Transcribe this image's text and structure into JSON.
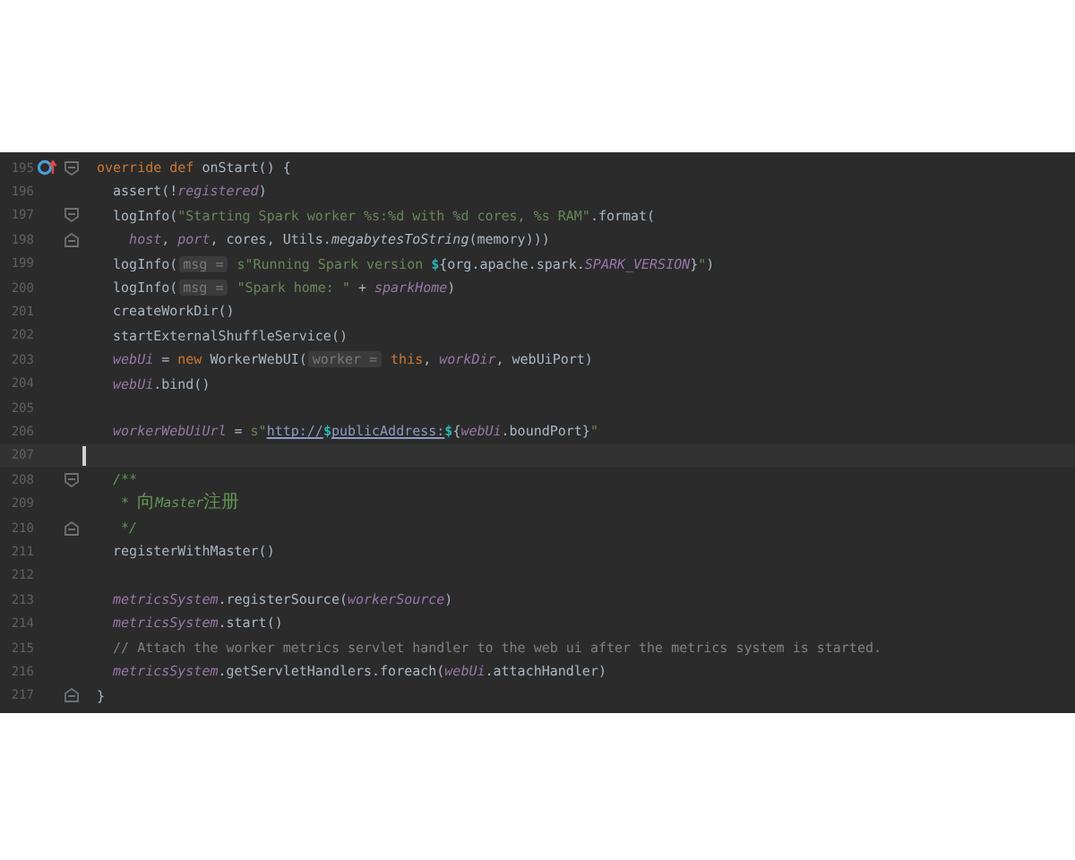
{
  "editor": {
    "lines": [
      {
        "number": "195",
        "overridden": true,
        "fold_start": true,
        "tokens": [
          {
            "kind": "keyword",
            "text": "override def "
          },
          {
            "kind": "plain",
            "text": "onStart() {"
          }
        ]
      },
      {
        "number": "196",
        "tokens": [
          {
            "kind": "plain",
            "text": "  assert(!"
          },
          {
            "kind": "field",
            "text": "registered"
          },
          {
            "kind": "plain",
            "text": ")"
          }
        ]
      },
      {
        "number": "197",
        "fold_start": true,
        "tokens": [
          {
            "kind": "plain",
            "text": "  logInfo("
          },
          {
            "kind": "string",
            "text": "\"Starting Spark worker %s:%d with %d cores, %s RAM\""
          },
          {
            "kind": "plain",
            "text": ".format("
          }
        ]
      },
      {
        "number": "198",
        "fold_end": true,
        "tokens": [
          {
            "kind": "field",
            "text": "    host"
          },
          {
            "kind": "plain",
            "text": ", "
          },
          {
            "kind": "field",
            "text": "port"
          },
          {
            "kind": "plain",
            "text": ", cores, Utils."
          },
          {
            "kind": "italic",
            "text": "megabytesToString"
          },
          {
            "kind": "plain",
            "text": "(memory)))"
          }
        ]
      },
      {
        "number": "199",
        "tokens": [
          {
            "kind": "plain",
            "text": "  logInfo("
          },
          {
            "kind": "hint",
            "text": "msg ="
          },
          {
            "kind": "string",
            "text": " s\"Running Spark version "
          },
          {
            "kind": "interp",
            "text": "$"
          },
          {
            "kind": "plain",
            "text": "{org.apache.spark."
          },
          {
            "kind": "field",
            "text": "SPARK_VERSION"
          },
          {
            "kind": "plain",
            "text": "}"
          },
          {
            "kind": "string",
            "text": "\""
          },
          {
            "kind": "plain",
            "text": ")"
          }
        ]
      },
      {
        "number": "200",
        "tokens": [
          {
            "kind": "plain",
            "text": "  logInfo("
          },
          {
            "kind": "hint",
            "text": "msg ="
          },
          {
            "kind": "string",
            "text": " \"Spark home: \""
          },
          {
            "kind": "plain",
            "text": " + "
          },
          {
            "kind": "field",
            "text": "sparkHome"
          },
          {
            "kind": "plain",
            "text": ")"
          }
        ]
      },
      {
        "number": "201",
        "tokens": [
          {
            "kind": "plain",
            "text": "  createWorkDir()"
          }
        ]
      },
      {
        "number": "202",
        "tokens": [
          {
            "kind": "plain",
            "text": "  startExternalShuffleService()"
          }
        ]
      },
      {
        "number": "203",
        "tokens": [
          {
            "kind": "field",
            "text": "  webUi"
          },
          {
            "kind": "plain",
            "text": " = "
          },
          {
            "kind": "keyword",
            "text": "new "
          },
          {
            "kind": "plain",
            "text": "WorkerWebUI("
          },
          {
            "kind": "hint",
            "text": "worker ="
          },
          {
            "kind": "keyword",
            "text": " this"
          },
          {
            "kind": "plain",
            "text": ", "
          },
          {
            "kind": "field",
            "text": "workDir"
          },
          {
            "kind": "plain",
            "text": ", webUiPort)"
          }
        ]
      },
      {
        "number": "204",
        "tokens": [
          {
            "kind": "field",
            "text": "  webUi"
          },
          {
            "kind": "plain",
            "text": ".bind()"
          }
        ]
      },
      {
        "number": "205"
      },
      {
        "number": "206",
        "tokens": [
          {
            "kind": "field",
            "text": "  workerWebUiUrl"
          },
          {
            "kind": "plain",
            "text": " = "
          },
          {
            "kind": "string",
            "text": "s\""
          },
          {
            "kind": "url",
            "text": "http://"
          },
          {
            "kind": "interp",
            "text": "$"
          },
          {
            "kind": "url",
            "text": "publicAddress:"
          },
          {
            "kind": "interp",
            "text": "$"
          },
          {
            "kind": "plain",
            "text": "{"
          },
          {
            "kind": "field",
            "text": "webUi"
          },
          {
            "kind": "plain",
            "text": ".boundPort}"
          },
          {
            "kind": "string",
            "text": "\""
          }
        ]
      },
      {
        "number": "207",
        "current": true
      },
      {
        "number": "208",
        "fold_start": true,
        "tokens": [
          {
            "kind": "doc",
            "text": "  /**"
          }
        ]
      },
      {
        "number": "209",
        "tokens": [
          {
            "kind": "doc",
            "text": "   * 向Master注册"
          }
        ]
      },
      {
        "number": "210",
        "fold_end": true,
        "tokens": [
          {
            "kind": "doc",
            "text": "   */"
          }
        ]
      },
      {
        "number": "211",
        "tokens": [
          {
            "kind": "plain",
            "text": "  registerWithMaster()"
          }
        ]
      },
      {
        "number": "212"
      },
      {
        "number": "213",
        "tokens": [
          {
            "kind": "field",
            "text": "  metricsSystem"
          },
          {
            "kind": "plain",
            "text": ".registerSource("
          },
          {
            "kind": "field",
            "text": "workerSource"
          },
          {
            "kind": "plain",
            "text": ")"
          }
        ]
      },
      {
        "number": "214",
        "tokens": [
          {
            "kind": "field",
            "text": "  metricsSystem"
          },
          {
            "kind": "plain",
            "text": ".start()"
          }
        ]
      },
      {
        "number": "215",
        "tokens": [
          {
            "kind": "comment",
            "text": "  // Attach the worker metrics servlet handler to the web ui after the metrics system is started."
          }
        ]
      },
      {
        "number": "216",
        "tokens": [
          {
            "kind": "field",
            "text": "  metricsSystem"
          },
          {
            "kind": "plain",
            "text": ".getServletHandlers.foreach("
          },
          {
            "kind": "field",
            "text": "webUi"
          },
          {
            "kind": "plain",
            "text": ".attachHandler)"
          }
        ]
      },
      {
        "number": "217",
        "fold_end": true,
        "tokens": [
          {
            "kind": "plain",
            "text": "}"
          }
        ]
      }
    ]
  }
}
